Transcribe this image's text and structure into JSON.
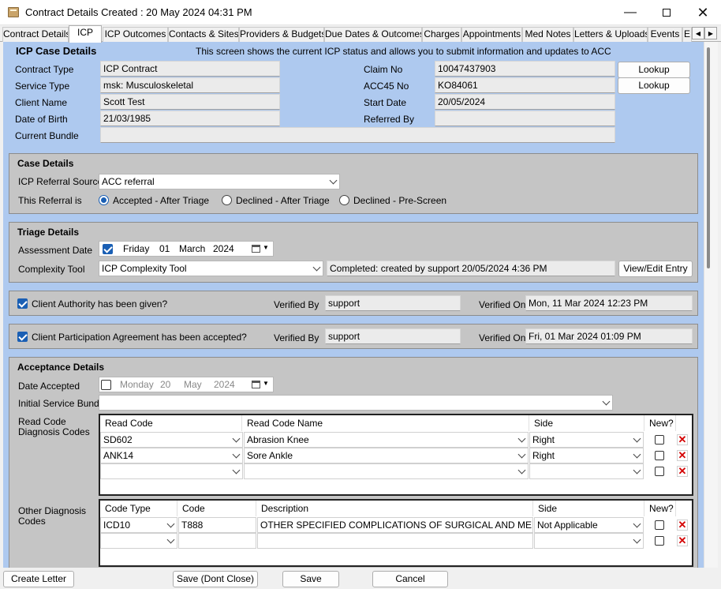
{
  "window": {
    "title": "Contract Details Created : 20 May 2024 04:31 PM"
  },
  "tabs": [
    "Contract Details",
    "ICP",
    "ICP Outcomes",
    "Contacts & Sites",
    "Providers & Budgets",
    "Due Dates & Outcomes",
    "Charges",
    "Appointments",
    "Med Notes",
    "Letters & Uploads",
    "Events",
    "E"
  ],
  "case": {
    "heading": "ICP Case Details",
    "info": "This screen shows the current ICP status and allows you to submit information and updates to ACC",
    "contract_type_label": "Contract Type",
    "contract_type": "ICP Contract",
    "service_type_label": "Service Type",
    "service_type": "msk: Musculoskeletal",
    "client_name_label": "Client Name",
    "client_name": "Scott Test",
    "dob_label": "Date of Birth",
    "dob": "21/03/1985",
    "bundle_label": "Current Bundle",
    "bundle": "",
    "claim_no_label": "Claim No",
    "claim_no": "10047437903",
    "acc45_label": "ACC45 No",
    "acc45": "KO84061",
    "start_date_label": "Start Date",
    "start_date": "20/05/2024",
    "referred_by_label": "Referred By",
    "referred_by": "",
    "lookup_label": "Lookup"
  },
  "case_details": {
    "heading": "Case Details",
    "source_label": "ICP Referral Source",
    "source": "ACC referral",
    "referral_label": "This Referral is",
    "options": [
      "Accepted - After Triage",
      "Declined - After Triage",
      "Declined - Pre-Screen"
    ],
    "selected": 0
  },
  "triage": {
    "heading": "Triage Details",
    "assessment_label": "Assessment Date",
    "date": {
      "weekday": "Friday",
      "day": "01",
      "month": "March",
      "year": "2024"
    },
    "complexity_label": "Complexity Tool",
    "complexity": "ICP Complexity Tool",
    "completed": "Completed:  created by support 20/05/2024 4:36 PM",
    "view_edit": "View/Edit Entry"
  },
  "authority": {
    "label": "Client Authority has been given?",
    "checked": true,
    "verified_by_label": "Verified By",
    "verified_by": "support",
    "verified_on_label": "Verified On",
    "verified_on": "Mon, 11 Mar 2024 12:23 PM"
  },
  "participation": {
    "label": "Client Participation Agreement has been accepted?",
    "checked": true,
    "verified_by_label": "Verified By",
    "verified_by": "support",
    "verified_on_label": "Verified On",
    "verified_on": "Fri, 01 Mar 2024 01:09 PM"
  },
  "acceptance": {
    "heading": "Acceptance Details",
    "date_label": "Date Accepted",
    "date": {
      "weekday": "Monday",
      "day": "20",
      "month": "May",
      "year": "2024"
    },
    "bundle_label": "Initial Service Bundle",
    "bundle": "",
    "read_code_label": "Read Code Diagnosis Codes",
    "read_headers": [
      "Read Code",
      "Read Code Name",
      "Side",
      "New?"
    ],
    "read_rows": [
      {
        "code": "SD602",
        "name": "Abrasion Knee",
        "side": "Right"
      },
      {
        "code": "ANK14",
        "name": "Sore Ankle",
        "side": "Right"
      },
      {
        "code": "",
        "name": "",
        "side": ""
      }
    ],
    "other_label": "Other Diagnosis Codes",
    "other_headers": [
      "Code Type",
      "Code",
      "Description",
      "Side",
      "New?"
    ],
    "other_rows": [
      {
        "type": "ICD10",
        "code": "T888",
        "desc": "OTHER SPECIFIED COMPLICATIONS OF SURGICAL AND MEDICA...",
        "side": "Not Applicable"
      },
      {
        "type": "",
        "code": "",
        "desc": "",
        "side": ""
      }
    ],
    "delete_glyph": "✕"
  },
  "footer": {
    "create_letter": "Create Letter",
    "save_dont_close": "Save (Dont Close)",
    "save": "Save",
    "cancel": "Cancel"
  }
}
